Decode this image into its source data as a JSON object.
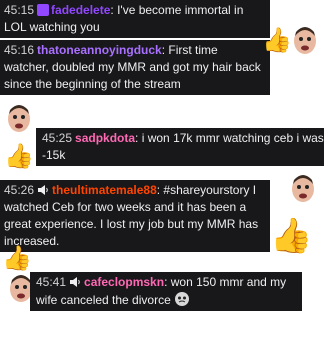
{
  "messages": [
    {
      "time": "45:15",
      "user": "fadedelete",
      "user_color": "#9147ff",
      "text": "I've become immortal in LOL watching you"
    },
    {
      "time": "45:16",
      "user": "thatoneannoyingduck",
      "user_color": "#a970ff",
      "text": "First time watcher, doubled my MMR and got my hair back since the beginning of the stream"
    },
    {
      "time": "45:25",
      "user": "sadpkdota",
      "user_color": "#ff69b4",
      "text": "i won 17k mmr watching ceb i was -15k"
    },
    {
      "time": "45:26",
      "user": "theultimatemale88",
      "user_color": "#ff4500",
      "text": "#shareyourstory I watched Ceb for two weeks and it has been a great experience. I lost my job but my MMR has increased."
    },
    {
      "time": "45:41",
      "user": "cafeclopmskn",
      "user_color": "#ff69b4",
      "text": "won 150 mmr and my wife canceled the divorce"
    }
  ],
  "icons": {
    "thumbs": "👍",
    "face": "face-emote-icon",
    "speaker": "speaker-icon",
    "badge": "subscriber-badge-icon"
  }
}
